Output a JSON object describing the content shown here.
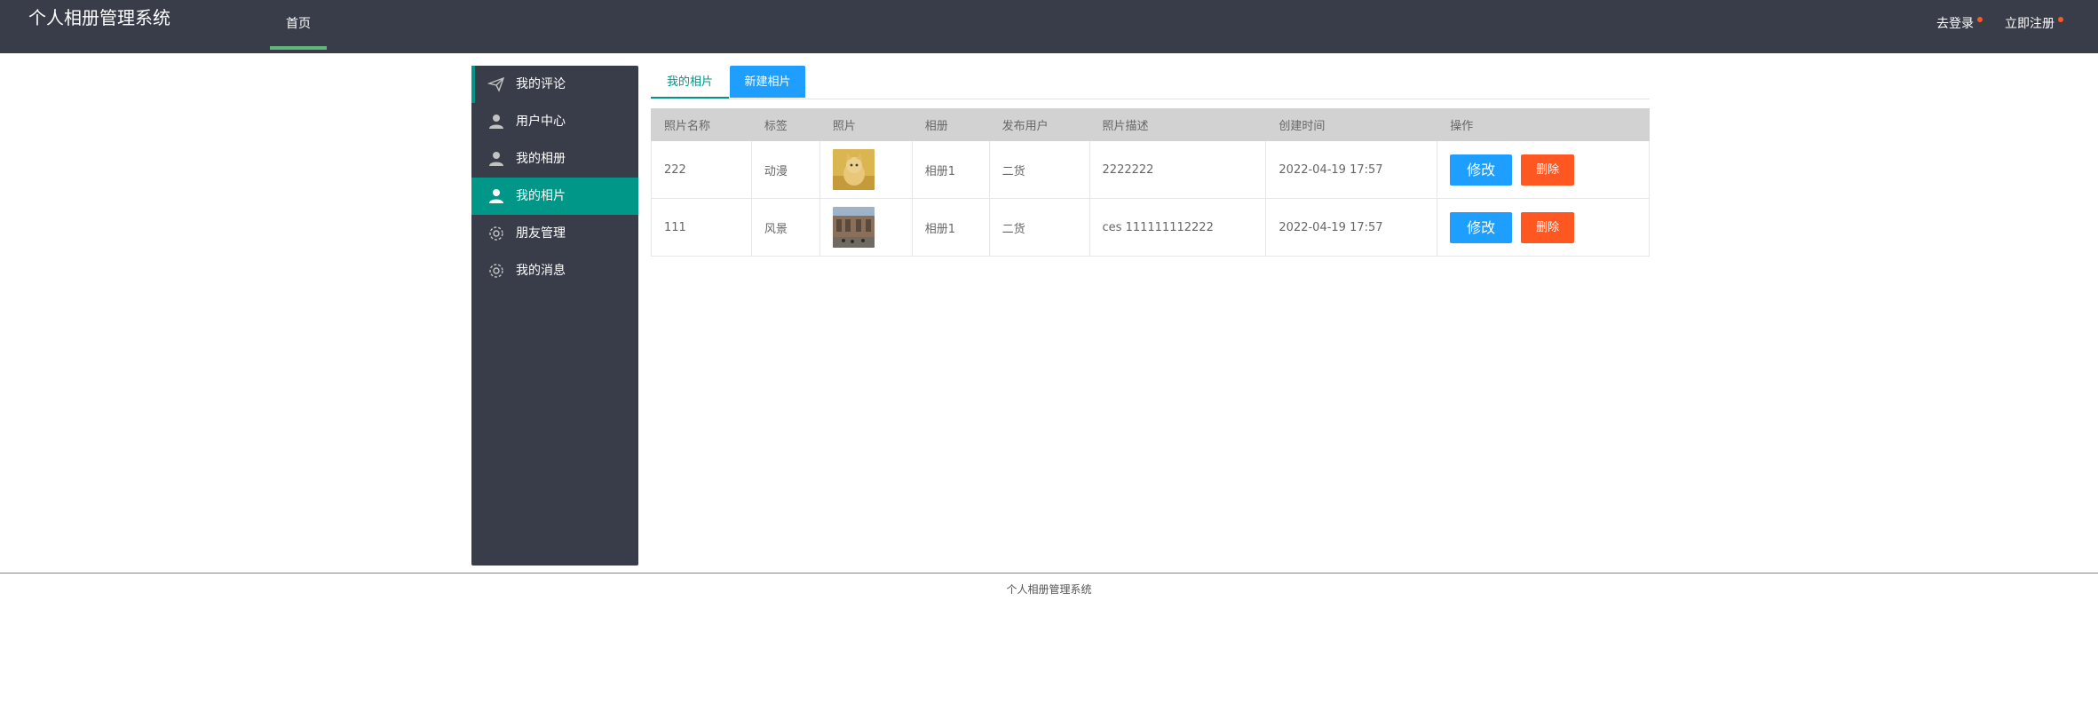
{
  "header": {
    "brand": "个人相册管理系统",
    "nav_home": "首页",
    "login": "去登录",
    "register": "立即注册"
  },
  "sidebar": {
    "items": [
      {
        "label": "我的评论",
        "icon": "paper-plane-icon"
      },
      {
        "label": "用户中心",
        "icon": "user-icon"
      },
      {
        "label": "我的相册",
        "icon": "user-icon"
      },
      {
        "label": "我的相片",
        "icon": "user-icon",
        "active": true
      },
      {
        "label": "朋友管理",
        "icon": "gear-icon"
      },
      {
        "label": "我的消息",
        "icon": "gear-icon"
      }
    ]
  },
  "tabs": {
    "mine": "我的相片",
    "new": "新建相片"
  },
  "table": {
    "headers": [
      "照片名称",
      "标签",
      "照片",
      "相册",
      "发布用户",
      "照片描述",
      "创建时间",
      "操作"
    ],
    "rows": [
      {
        "name": "222",
        "tag": "动漫",
        "album": "相册1",
        "user": "二货",
        "desc": "2222222",
        "time": "2022-04-19 17:57",
        "thumb": "cat photo"
      },
      {
        "name": "111",
        "tag": "风景",
        "album": "相册1",
        "user": "二货",
        "desc": "ces 111111112222",
        "time": "2022-04-19 17:57",
        "thumb": "building photo"
      }
    ],
    "edit_label": "修改",
    "delete_label": "删除"
  },
  "footer": {
    "text": "个人相册管理系统"
  },
  "colors": {
    "header_bg": "#393d49",
    "accent": "#009688",
    "primary_button": "#1e9fff",
    "danger_button": "#ff5722"
  }
}
